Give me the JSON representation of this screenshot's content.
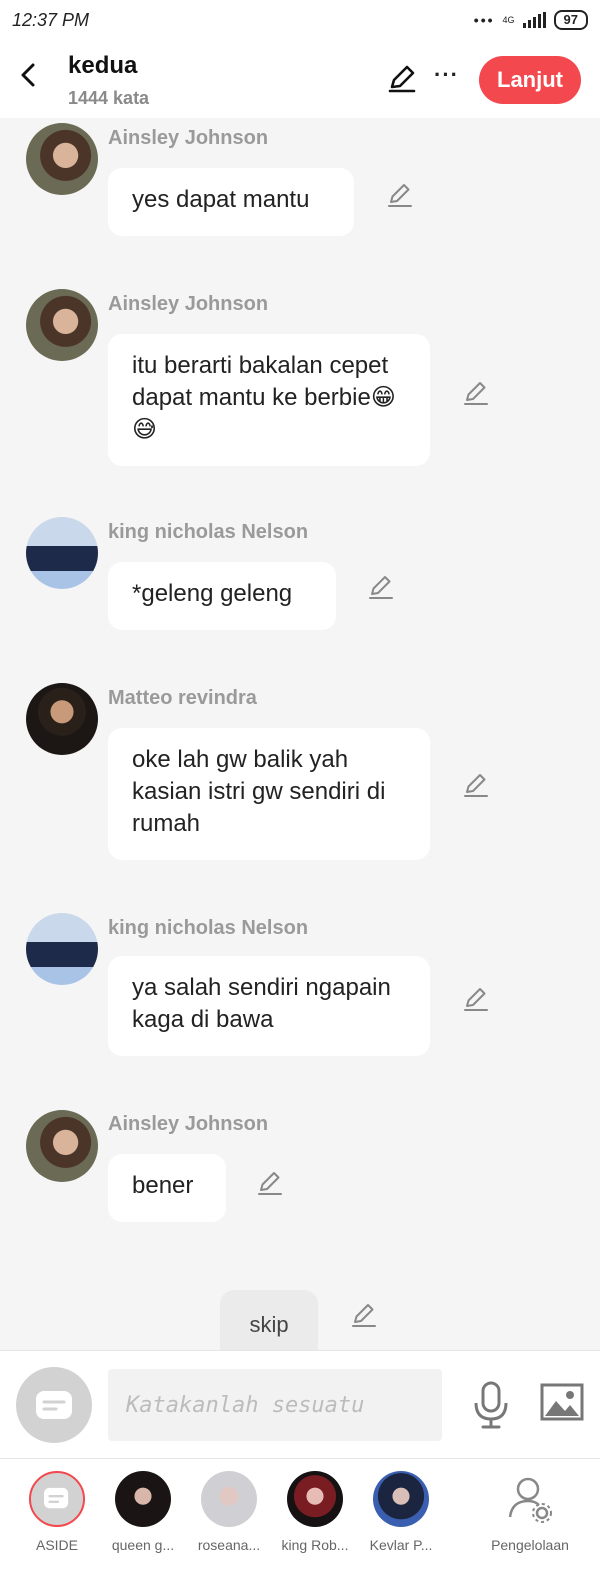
{
  "status": {
    "time": "12:37 PM",
    "network": "4G",
    "battery": "97"
  },
  "header": {
    "title": "kedua",
    "word_count": "1444 kata",
    "next_label": "Lanjut"
  },
  "messages": [
    {
      "author": "Ainsley Johnson",
      "text": "yes dapat mantu"
    },
    {
      "author": "Ainsley Johnson",
      "text": "itu berarti bakalan cepet dapat mantu ke berbie😁😅"
    },
    {
      "author": "king nicholas Nelson",
      "text": "*geleng geleng"
    },
    {
      "author": "Matteo revindra",
      "text": "oke lah gw balik yah kasian istri gw sendiri di rumah"
    },
    {
      "author": "king nicholas Nelson",
      "text": "ya salah sendiri ngapain kaga di bawa"
    },
    {
      "author": "Ainsley Johnson",
      "text": "bener"
    }
  ],
  "skip": "skip",
  "input": {
    "placeholder": "Katakanlah sesuatu"
  },
  "tabs": [
    {
      "label": "ASIDE"
    },
    {
      "label": "queen g..."
    },
    {
      "label": "roseana..."
    },
    {
      "label": "king Rob..."
    },
    {
      "label": "Kevlar P..."
    },
    {
      "label": "Pengelolaan"
    }
  ],
  "colors": {
    "accent": "#f2484e",
    "background": "#f5f5f5",
    "bubble": "#ffffff",
    "muted": "#9a9a9a"
  },
  "icons": {
    "back": "chevron-left-icon",
    "edit": "pencil-icon",
    "more": "more-dots-icon",
    "mic": "microphone-icon",
    "image": "image-icon",
    "manage": "user-settings-icon"
  }
}
